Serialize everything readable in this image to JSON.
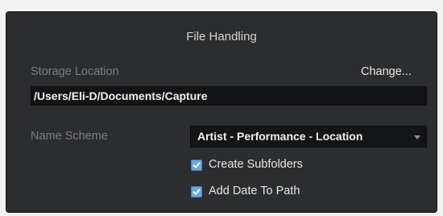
{
  "panel": {
    "title": "File Handling"
  },
  "storage": {
    "label": "Storage Location",
    "change_label": "Change...",
    "path": "/Users/Eli-D/Documents/Capture"
  },
  "name_scheme": {
    "label": "Name Scheme",
    "selected": "Artist - Performance - Location"
  },
  "options": {
    "create_subfolders": {
      "label": "Create Subfolders",
      "checked": true
    },
    "add_date_to_path": {
      "label": "Add Date To Path",
      "checked": true
    }
  },
  "colors": {
    "panel_bg": "#2c2d2f",
    "field_bg": "#131416",
    "checkbox_accent": "#6ea8dc"
  },
  "icons": {
    "checkbox": "checkmark-icon",
    "dropdown": "chevron-down-icon"
  }
}
